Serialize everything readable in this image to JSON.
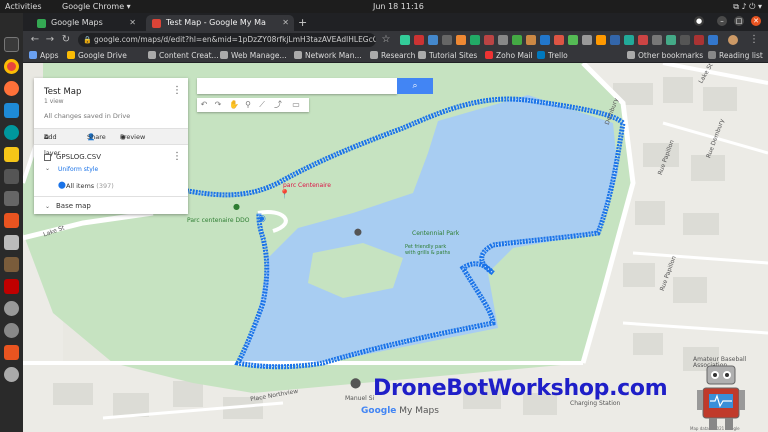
{
  "os": {
    "activities": "Activities",
    "app_name": "Google Chrome",
    "clock": "Jun 18  11:16"
  },
  "browser": {
    "tabs": [
      {
        "label": "Google Maps"
      },
      {
        "label": "Test Map - Google My Ma"
      }
    ],
    "url": "google.com/maps/d/edit?hl=en&mid=1pDzZY08rfkjLmH3tazAVEAdlHLEGcGcG&ll...",
    "bookmarks": [
      "Apps",
      "Google Drive",
      "Content Creat...",
      "Web Manage...",
      "Network Man...",
      "Research",
      "Tutorial Sites",
      "Zoho Mail",
      "Trello",
      "Other bookmarks",
      "Reading list"
    ]
  },
  "panel": {
    "title": "Test Map",
    "views": "1 view",
    "saved": "All changes saved in Drive",
    "add_layer": "Add layer",
    "share": "Share",
    "preview": "Preview",
    "layer_name": "GPSLOG.CSV",
    "style": "Uniform style",
    "items": "All items",
    "items_count": "(397)",
    "base_map": "Base map"
  },
  "map": {
    "labels": {
      "parc_pin": "parc Centenaire",
      "parc_ddo": "Parc centenaire DDO",
      "park_name": "Centennial Park",
      "park_desc": "Pet friendly park with grills & paths",
      "lake_st_1": "Lake St",
      "lake_st_2": "Lake St",
      "papillon_1": "Rue Papillon",
      "papillon_2": "Rue Papillon",
      "manuel": "Manuel Si",
      "charging": "Charging Station",
      "baseball": "Amateur Baseball Association",
      "northview": "Place Northview",
      "dembury": "Dembury",
      "dembury2": "Rue Dembury"
    },
    "credit": "Map data ©2021 Google",
    "google_logo": "Google",
    "my_maps": " My Maps"
  },
  "watermark": "DroneBotWorkshop.com",
  "colors": {
    "track": "#1a73e8",
    "water": "#a8cdf2",
    "park": "#c5e4c0",
    "accent": "#4285f4"
  }
}
